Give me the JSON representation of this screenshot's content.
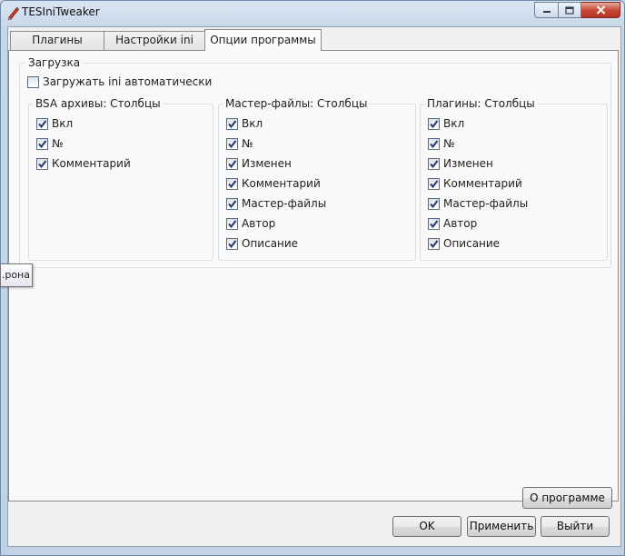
{
  "window": {
    "title": "TESIniTweaker",
    "icon": "pen-icon"
  },
  "tabs": [
    {
      "label": "Плагины",
      "active": false
    },
    {
      "label": "Настройки ini",
      "active": false
    },
    {
      "label": "Опции программы",
      "active": true
    }
  ],
  "loading": {
    "title": "Загрузка",
    "auto_load": {
      "label": "Загружать ini автоматически",
      "checked": false
    }
  },
  "bsa_columns": {
    "title": "BSA архивы: Столбцы",
    "items": [
      {
        "label": "Вкл",
        "checked": true
      },
      {
        "label": "№",
        "checked": true
      },
      {
        "label": "Комментарий",
        "checked": true
      }
    ]
  },
  "master_columns": {
    "title": "Мастер-файлы: Столбцы",
    "items": [
      {
        "label": "Вкл",
        "checked": true
      },
      {
        "label": "№",
        "checked": true
      },
      {
        "label": "Изменен",
        "checked": true
      },
      {
        "label": "Комментарий",
        "checked": true
      },
      {
        "label": "Мастер-файлы",
        "checked": true
      },
      {
        "label": "Автор",
        "checked": true
      },
      {
        "label": "Описание",
        "checked": true
      }
    ]
  },
  "plugin_columns": {
    "title": "Плагины: Столбцы",
    "items": [
      {
        "label": "Вкл",
        "checked": true
      },
      {
        "label": "№",
        "checked": true
      },
      {
        "label": "Изменен",
        "checked": true
      },
      {
        "label": "Комментарий",
        "checked": true
      },
      {
        "label": "Мастер-файлы",
        "checked": true
      },
      {
        "label": "Автор",
        "checked": true
      },
      {
        "label": "Описание",
        "checked": true
      }
    ]
  },
  "tooltip": {
    "text": "рона."
  },
  "buttons": {
    "about": "О программе",
    "ok": "OK",
    "apply": "Применить",
    "exit": "Выйти"
  }
}
